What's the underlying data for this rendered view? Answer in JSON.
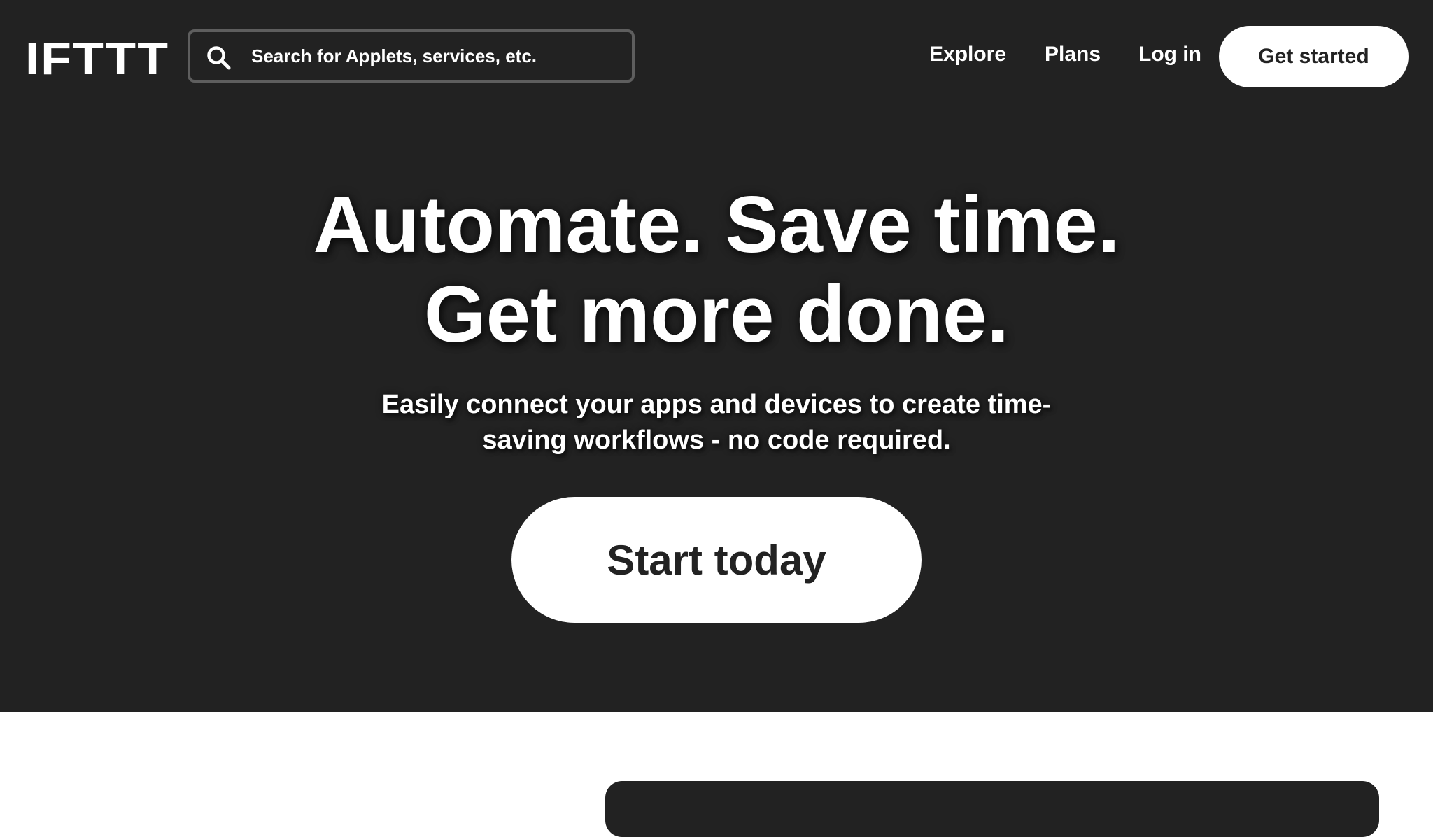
{
  "nav": {
    "logo": "IFTTT",
    "search": {
      "placeholder": "Search for Applets, services, etc.",
      "value": ""
    },
    "links": {
      "explore": "Explore",
      "plans": "Plans",
      "login": "Log in"
    },
    "cta": "Get started"
  },
  "hero": {
    "headline_line1": "Automate. Save time.",
    "headline_line2": "Get more done.",
    "subhead": "Easily connect your apps and devices to create time-saving workflows - no code required.",
    "cta": "Start today"
  },
  "icons": {
    "search": "search-icon"
  },
  "colors": {
    "hero_bg": "#222222",
    "text": "#ffffff",
    "button_bg": "#ffffff",
    "button_text": "#222222",
    "search_border": "#5e5e5e"
  }
}
